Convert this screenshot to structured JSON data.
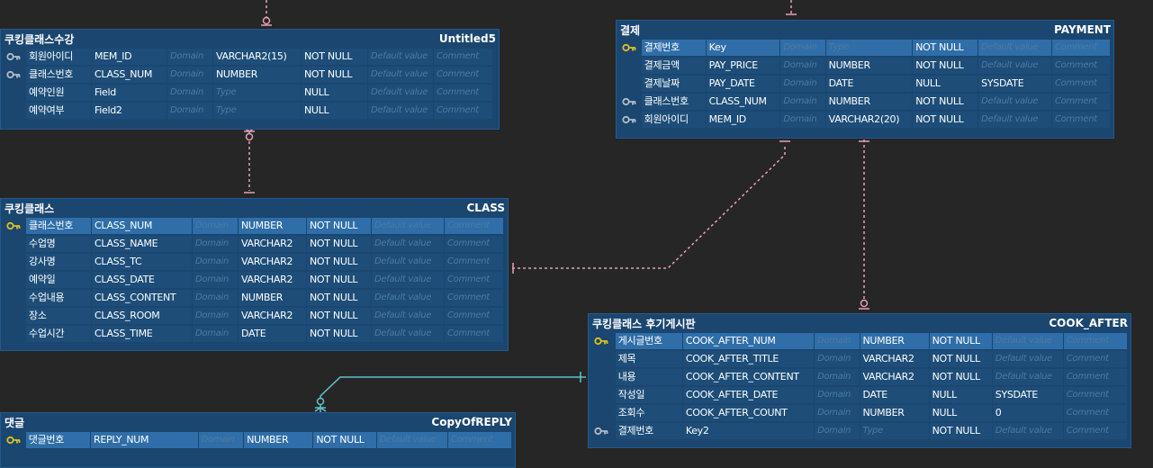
{
  "entities": {
    "untitled5": {
      "display_name": "쿠킹클래스수강",
      "physical_name": "Untitled5",
      "columns": [
        {
          "key": "fk",
          "name": "회원아이디",
          "field": "MEM_ID",
          "domain": "Domain",
          "type": "VARCHAR2(15)",
          "null": "NOT NULL",
          "default": "Default value",
          "comment": "Comment"
        },
        {
          "key": "fk",
          "name": "클래스번호",
          "field": "CLASS_NUM",
          "domain": "Domain",
          "type": "NUMBER",
          "null": "NOT NULL",
          "default": "Default value",
          "comment": "Comment"
        },
        {
          "key": "",
          "name": "예약인원",
          "field": "Field",
          "domain": "Domain",
          "type": "Type",
          "null": "NULL",
          "default": "Default value",
          "comment": "Comment"
        },
        {
          "key": "",
          "name": "예약여부",
          "field": "Field2",
          "domain": "Domain",
          "type": "Type",
          "null": "NULL",
          "default": "Default value",
          "comment": "Comment"
        }
      ]
    },
    "payment": {
      "display_name": "결제",
      "physical_name": "PAYMENT",
      "columns": [
        {
          "key": "pk",
          "name": "결제번호",
          "field": "Key",
          "domain": "Domain",
          "type": "Type",
          "null": "NOT NULL",
          "default": "Default value",
          "comment": "Comment"
        },
        {
          "key": "",
          "name": "결제금액",
          "field": "PAY_PRICE",
          "domain": "Domain",
          "type": "NUMBER",
          "null": "NOT NULL",
          "default": "Default value",
          "comment": "Comment"
        },
        {
          "key": "",
          "name": "결제날짜",
          "field": "PAY_DATE",
          "domain": "Domain",
          "type": "DATE",
          "null": "NULL",
          "default": "SYSDATE",
          "comment": "Comment"
        },
        {
          "key": "fk",
          "name": "클래스번호",
          "field": "CLASS_NUM",
          "domain": "Domain",
          "type": "NUMBER",
          "null": "NOT NULL",
          "default": "Default value",
          "comment": "Comment"
        },
        {
          "key": "fk",
          "name": "회원아이디",
          "field": "MEM_ID",
          "domain": "Domain",
          "type": "VARCHAR2(20)",
          "null": "NOT NULL",
          "default": "Default value",
          "comment": "Comment"
        }
      ]
    },
    "class": {
      "display_name": "쿠킹클래스",
      "physical_name": "CLASS",
      "columns": [
        {
          "key": "pk",
          "name": "클래스번호",
          "field": "CLASS_NUM",
          "domain": "Domain",
          "type": "NUMBER",
          "null": "NOT NULL",
          "default": "Default value",
          "comment": "Comment"
        },
        {
          "key": "",
          "name": "수업명",
          "field": "CLASS_NAME",
          "domain": "Domain",
          "type": "VARCHAR2",
          "null": "NOT NULL",
          "default": "Default value",
          "comment": "Comment"
        },
        {
          "key": "",
          "name": "강사명",
          "field": "CLASS_TC",
          "domain": "Domain",
          "type": "VARCHAR2",
          "null": "NOT NULL",
          "default": "Default value",
          "comment": "Comment"
        },
        {
          "key": "",
          "name": "예약일",
          "field": "CLASS_DATE",
          "domain": "Domain",
          "type": "VARCHAR2",
          "null": "NOT NULL",
          "default": "Default value",
          "comment": "Comment"
        },
        {
          "key": "",
          "name": "수업내용",
          "field": "CLASS_CONTENT",
          "domain": "Domain",
          "type": "NUMBER",
          "null": "NOT NULL",
          "default": "Default value",
          "comment": "Comment"
        },
        {
          "key": "",
          "name": "장소",
          "field": "CLASS_ROOM",
          "domain": "Domain",
          "type": "VARCHAR2",
          "null": "NOT NULL",
          "default": "Default value",
          "comment": "Comment"
        },
        {
          "key": "",
          "name": "수업시간",
          "field": "CLASS_TIME",
          "domain": "Domain",
          "type": "DATE",
          "null": "NOT NULL",
          "default": "Default value",
          "comment": "Comment"
        }
      ]
    },
    "cook_after": {
      "display_name": "쿠킹클래스 후기게시판",
      "physical_name": "COOK_AFTER",
      "columns": [
        {
          "key": "pk",
          "name": "게시글번호",
          "field": "COOK_AFTER_NUM",
          "domain": "Domain",
          "type": "NUMBER",
          "null": "NOT NULL",
          "default": "Default value",
          "comment": "Comment"
        },
        {
          "key": "",
          "name": "제목",
          "field": "COOK_AFTER_TITLE",
          "domain": "Domain",
          "type": "VARCHAR2",
          "null": "NOT NULL",
          "default": "Default value",
          "comment": "Comment"
        },
        {
          "key": "",
          "name": "내용",
          "field": "COOK_AFTER_CONTENT",
          "domain": "Domain",
          "type": "VARCHAR2",
          "null": "NOT NULL",
          "default": "Default value",
          "comment": "Comment"
        },
        {
          "key": "",
          "name": "작성일",
          "field": "COOK_AFTER_DATE",
          "domain": "Domain",
          "type": "DATE",
          "null": "NULL",
          "default": "SYSDATE",
          "comment": "Comment"
        },
        {
          "key": "",
          "name": "조회수",
          "field": "COOK_AFTER_COUNT",
          "domain": "Domain",
          "type": "NUMBER",
          "null": "NULL",
          "default": "0",
          "comment": "Comment"
        },
        {
          "key": "fk",
          "name": "결제번호",
          "field": "Key2",
          "domain": "Domain",
          "type": "Type",
          "null": "NOT NULL",
          "default": "Default value",
          "comment": "Comment"
        }
      ]
    },
    "copy_of_reply": {
      "display_name": "댓글",
      "physical_name": "CopyOfREPLY",
      "columns": [
        {
          "key": "pk",
          "name": "댓글번호",
          "field": "REPLY_NUM",
          "domain": "Domain",
          "type": "NUMBER",
          "null": "NOT NULL",
          "default": "Default value",
          "comment": "Comment"
        }
      ]
    }
  },
  "colors": {
    "background": "#262626",
    "entity_body": "#1a4670",
    "cell": "#1d4d78",
    "pk_row": "#2f6ea8",
    "placeholder": "#4f7a9e",
    "relation_dashed": "#e8a0b4",
    "relation_solid": "#5fc4cf",
    "key_gold": "#e0c020",
    "key_gray": "#b5bcc4"
  }
}
